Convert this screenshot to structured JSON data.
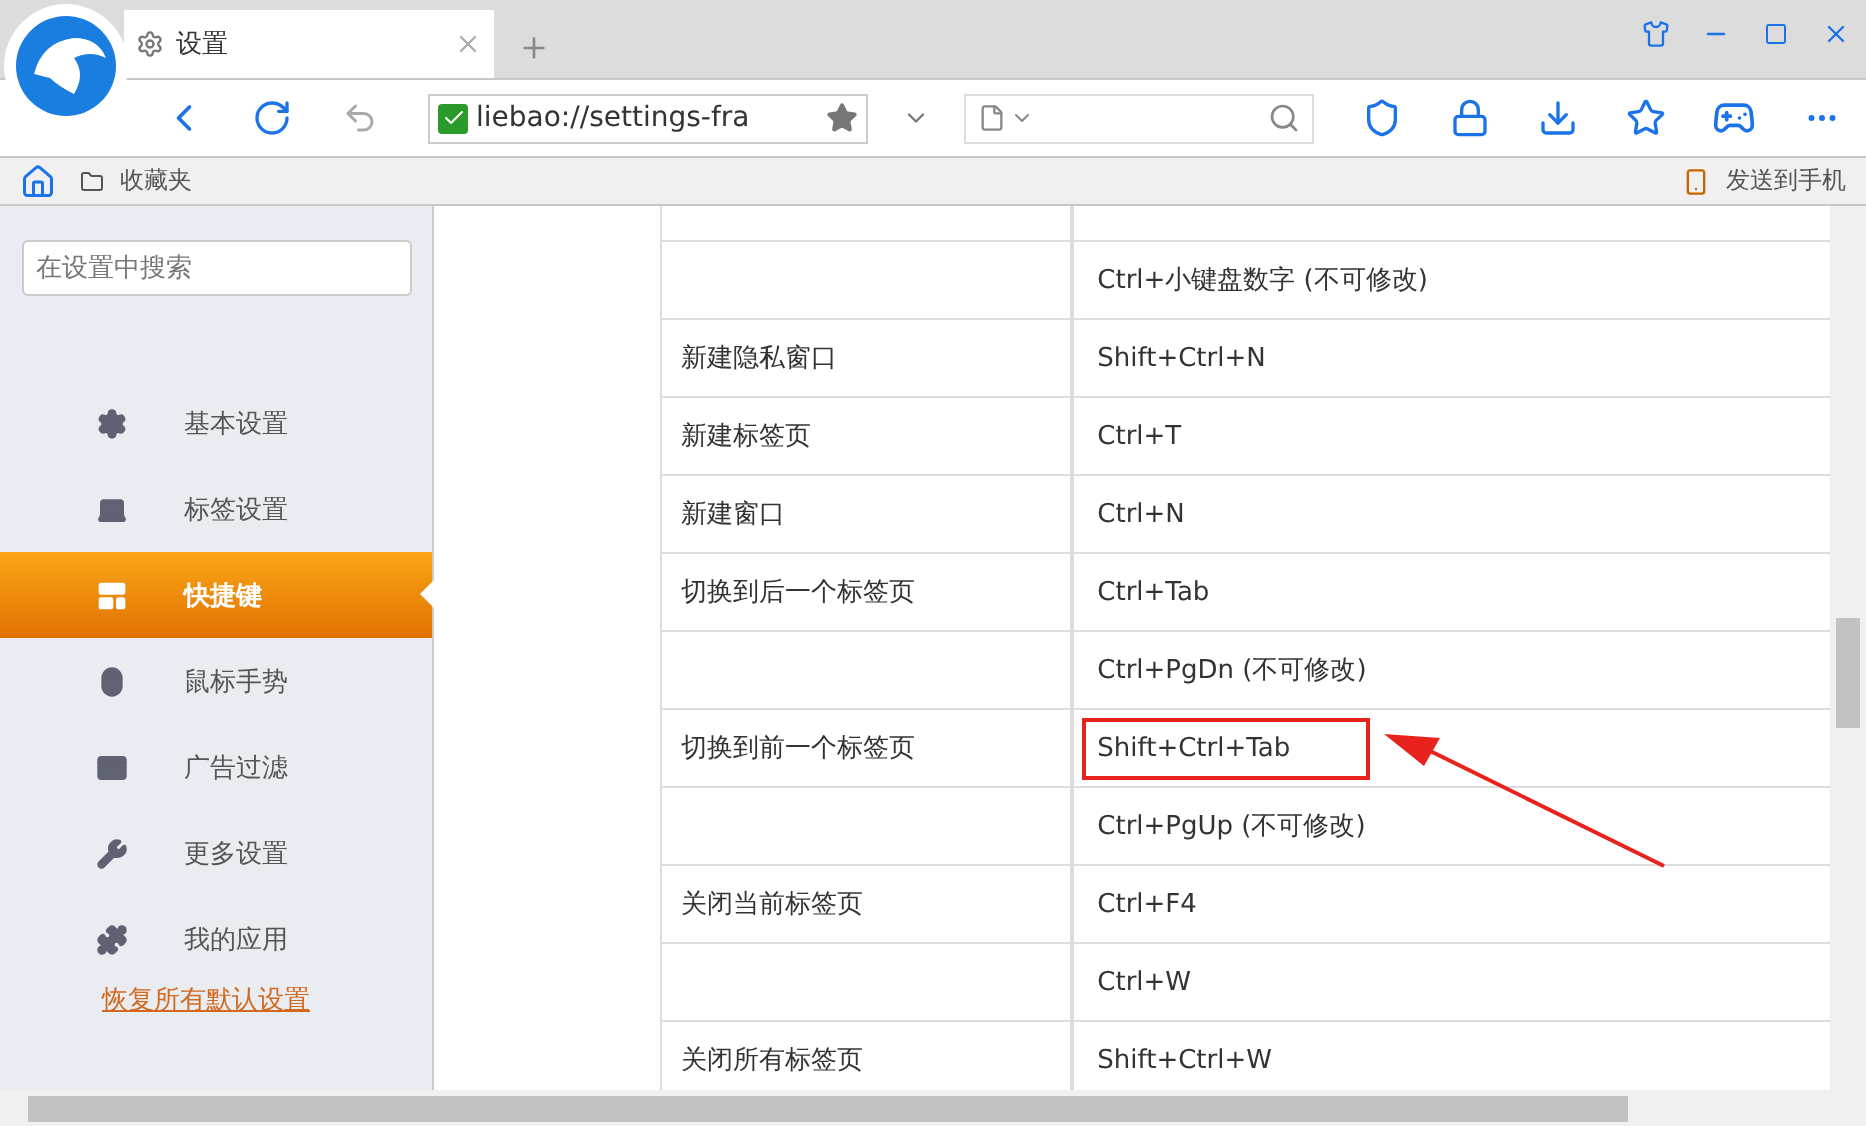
{
  "tab": {
    "title": "设置"
  },
  "address": {
    "url": "liebao://settings-fra"
  },
  "bookmarks_bar": {
    "items": [
      "收藏夹"
    ],
    "send_to_phone": "发送到手机"
  },
  "sidebar": {
    "search": {
      "placeholder": "在设置中搜索"
    },
    "items": [
      {
        "label": "基本设置",
        "selected": false
      },
      {
        "label": "标签设置",
        "selected": false
      },
      {
        "label": "快捷键",
        "selected": true
      },
      {
        "label": "鼠标手势",
        "selected": false
      },
      {
        "label": "广告过滤",
        "selected": false
      },
      {
        "label": "更多设置",
        "selected": false
      },
      {
        "label": "我的应用",
        "selected": false
      }
    ],
    "restore_link": "恢复所有默认设置"
  },
  "shortcuts": [
    {
      "keys": "Ctrl+小键盘数字 (不可修改)",
      "highlighted": false
    },
    {
      "action": "新建隐私窗口",
      "keys": "Shift+Ctrl+N",
      "highlighted": false
    },
    {
      "action": "新建标签页",
      "keys": "Ctrl+T",
      "highlighted": false
    },
    {
      "action": "新建窗口",
      "keys": "Ctrl+N",
      "highlighted": false
    },
    {
      "action": "切换到后一个标签页",
      "keys": "Ctrl+Tab",
      "highlighted": false
    },
    {
      "keys": "Ctrl+PgDn (不可修改)",
      "highlighted": false
    },
    {
      "action": "切换到前一个标签页",
      "keys": "Shift+Ctrl+Tab",
      "highlighted": true
    },
    {
      "keys": "Ctrl+PgUp (不可修改)",
      "highlighted": false
    },
    {
      "action": "关闭当前标签页",
      "keys": "Ctrl+F4",
      "highlighted": false
    },
    {
      "keys": "Ctrl+W",
      "highlighted": false
    },
    {
      "action": "关闭所有标签页",
      "keys": "Shift+Ctrl+W",
      "highlighted": false
    }
  ]
}
